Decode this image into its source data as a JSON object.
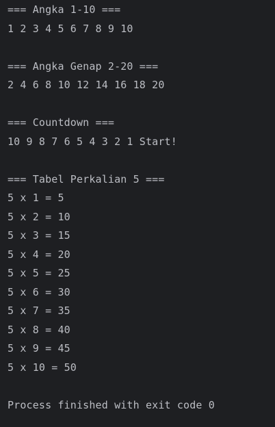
{
  "console": {
    "lines": [
      "=== Angka 1-10 ===",
      "1 2 3 4 5 6 7 8 9 10",
      "",
      "=== Angka Genap 2-20 ===",
      "2 4 6 8 10 12 14 16 18 20",
      "",
      "=== Countdown ===",
      "10 9 8 7 6 5 4 3 2 1 Start!",
      "",
      "=== Tabel Perkalian 5 ===",
      "5 x 1 = 5",
      "5 x 2 = 10",
      "5 x 3 = 15",
      "5 x 4 = 20",
      "5 x 5 = 25",
      "5 x 6 = 30",
      "5 x 7 = 35",
      "5 x 8 = 40",
      "5 x 9 = 45",
      "5 x 10 = 50",
      "",
      "Process finished with exit code 0"
    ]
  },
  "colors": {
    "background": "#1e1f22",
    "text": "#bcbec4"
  }
}
